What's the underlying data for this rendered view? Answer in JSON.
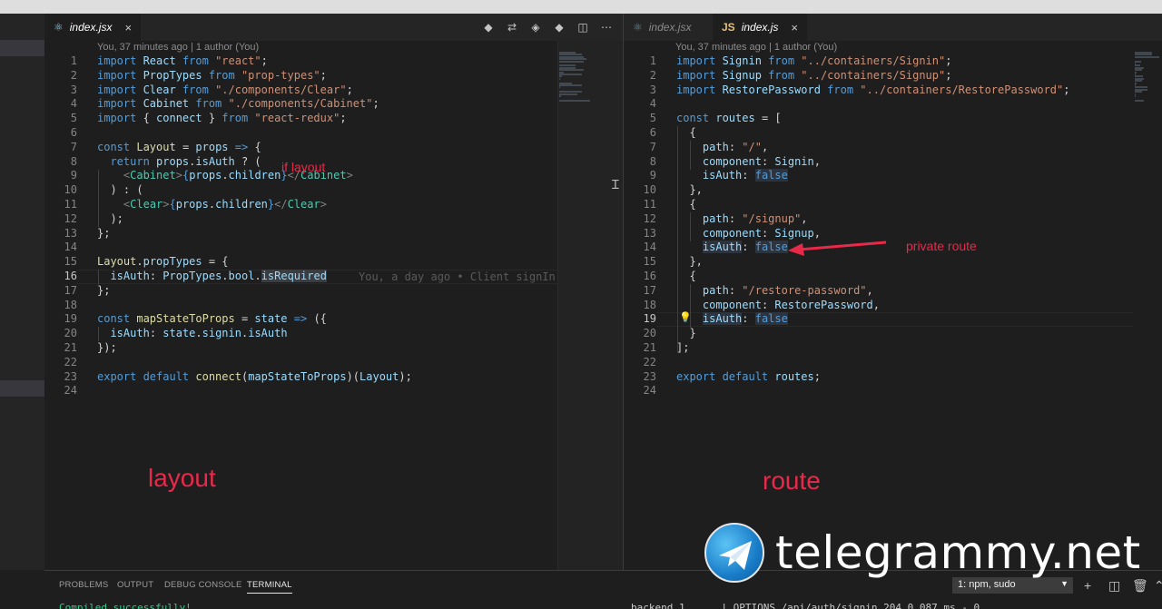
{
  "left_editor": {
    "tab_label": "index.jsx",
    "tab_close": "×",
    "blame": "You, 37 minutes ago | 1 author (You)",
    "ghost_text": "You, a day ago • Client signIn",
    "lines": [
      {
        "n": "1",
        "segs": [
          [
            "kw",
            "import "
          ],
          [
            "va",
            "React "
          ],
          [
            "kw",
            "from "
          ],
          [
            "st",
            "\"react\""
          ],
          [
            "pl",
            ";"
          ]
        ]
      },
      {
        "n": "2",
        "segs": [
          [
            "kw",
            "import "
          ],
          [
            "va",
            "PropTypes "
          ],
          [
            "kw",
            "from "
          ],
          [
            "st",
            "\"prop-types\""
          ],
          [
            "pl",
            ";"
          ]
        ]
      },
      {
        "n": "3",
        "segs": [
          [
            "kw",
            "import "
          ],
          [
            "va",
            "Clear "
          ],
          [
            "kw",
            "from "
          ],
          [
            "st",
            "\"./components/Clear\""
          ],
          [
            "pl",
            ";"
          ]
        ]
      },
      {
        "n": "4",
        "segs": [
          [
            "kw",
            "import "
          ],
          [
            "va",
            "Cabinet "
          ],
          [
            "kw",
            "from "
          ],
          [
            "st",
            "\"./components/Cabinet\""
          ],
          [
            "pl",
            ";"
          ]
        ]
      },
      {
        "n": "5",
        "segs": [
          [
            "kw",
            "import "
          ],
          [
            "pl",
            "{ "
          ],
          [
            "va",
            "connect "
          ],
          [
            "pl",
            "} "
          ],
          [
            "kw",
            "from "
          ],
          [
            "st",
            "\"react-redux\""
          ],
          [
            "pl",
            ";"
          ]
        ]
      },
      {
        "n": "6",
        "segs": []
      },
      {
        "n": "7",
        "segs": [
          [
            "kw",
            "const "
          ],
          [
            "fn",
            "Layout "
          ],
          [
            "pl",
            "= "
          ],
          [
            "va",
            "props "
          ],
          [
            "kw",
            "=> "
          ],
          [
            "pl",
            "{"
          ]
        ]
      },
      {
        "n": "8",
        "segs": [
          [
            "pl",
            "  "
          ],
          [
            "kw",
            "return "
          ],
          [
            "va",
            "props"
          ],
          [
            "pl",
            "."
          ],
          [
            "va",
            "isAuth "
          ],
          [
            "pl",
            "? ("
          ]
        ]
      },
      {
        "n": "9",
        "segs": [
          [
            "pl",
            "    "
          ],
          [
            "tgc",
            "<"
          ],
          [
            "ty",
            "Cabinet"
          ],
          [
            "tgc",
            ">"
          ],
          [
            "kw",
            "{"
          ],
          [
            "va",
            "props"
          ],
          [
            "pl",
            "."
          ],
          [
            "va",
            "children"
          ],
          [
            "kw",
            "}"
          ],
          [
            "tgc",
            "</"
          ],
          [
            "ty",
            "Cabinet"
          ],
          [
            "tgc",
            ">"
          ]
        ]
      },
      {
        "n": "10",
        "segs": [
          [
            "pl",
            "  ) : ("
          ]
        ]
      },
      {
        "n": "11",
        "segs": [
          [
            "pl",
            "    "
          ],
          [
            "tgc",
            "<"
          ],
          [
            "ty",
            "Clear"
          ],
          [
            "tgc",
            ">"
          ],
          [
            "kw",
            "{"
          ],
          [
            "va",
            "props"
          ],
          [
            "pl",
            "."
          ],
          [
            "va",
            "children"
          ],
          [
            "kw",
            "}"
          ],
          [
            "tgc",
            "</"
          ],
          [
            "ty",
            "Clear"
          ],
          [
            "tgc",
            ">"
          ]
        ]
      },
      {
        "n": "12",
        "segs": [
          [
            "pl",
            "  );"
          ]
        ]
      },
      {
        "n": "13",
        "segs": [
          [
            "pl",
            "};"
          ]
        ]
      },
      {
        "n": "14",
        "segs": []
      },
      {
        "n": "15",
        "segs": [
          [
            "fn",
            "Layout"
          ],
          [
            "pl",
            "."
          ],
          [
            "va",
            "propTypes "
          ],
          [
            "pl",
            "= {"
          ]
        ]
      },
      {
        "n": "16",
        "segs": [
          [
            "pl",
            "  "
          ],
          [
            "va",
            "isAuth"
          ],
          [
            "pl",
            ": "
          ],
          [
            "va",
            "PropTypes"
          ],
          [
            "pl",
            "."
          ],
          [
            "va",
            "bool"
          ],
          [
            "pl",
            "."
          ],
          [
            "hl",
            "isRequired"
          ]
        ]
      },
      {
        "n": "17",
        "segs": [
          [
            "pl",
            "};"
          ]
        ]
      },
      {
        "n": "18",
        "segs": []
      },
      {
        "n": "19",
        "segs": [
          [
            "kw",
            "const "
          ],
          [
            "fn",
            "mapStateToProps "
          ],
          [
            "pl",
            "= "
          ],
          [
            "va",
            "state "
          ],
          [
            "kw",
            "=> "
          ],
          [
            "pl",
            "({"
          ]
        ]
      },
      {
        "n": "20",
        "segs": [
          [
            "pl",
            "  "
          ],
          [
            "va",
            "isAuth"
          ],
          [
            "pl",
            ": "
          ],
          [
            "va",
            "state"
          ],
          [
            "pl",
            "."
          ],
          [
            "va",
            "signin"
          ],
          [
            "pl",
            "."
          ],
          [
            "va",
            "isAuth"
          ]
        ]
      },
      {
        "n": "21",
        "segs": [
          [
            "pl",
            "});"
          ]
        ]
      },
      {
        "n": "22",
        "segs": []
      },
      {
        "n": "23",
        "segs": [
          [
            "kw",
            "export "
          ],
          [
            "kw",
            "default "
          ],
          [
            "fn",
            "connect"
          ],
          [
            "pl",
            "("
          ],
          [
            "va",
            "mapStateToProps"
          ],
          [
            "pl",
            ")("
          ],
          [
            "va",
            "Layout"
          ],
          [
            "pl",
            ");"
          ]
        ]
      },
      {
        "n": "24",
        "segs": []
      }
    ]
  },
  "right_editor": {
    "tab_inactive_label": "index.jsx",
    "tab_active_label": "index.js",
    "js_badge": "JS",
    "blame": "You, 37 minutes ago | 1 author (You)",
    "lines": [
      {
        "n": "1",
        "segs": [
          [
            "kw",
            "import "
          ],
          [
            "va",
            "Signin "
          ],
          [
            "kw",
            "from "
          ],
          [
            "st",
            "\"../containers/Signin\""
          ],
          [
            "pl",
            ";"
          ]
        ]
      },
      {
        "n": "2",
        "segs": [
          [
            "kw",
            "import "
          ],
          [
            "va",
            "Signup "
          ],
          [
            "kw",
            "from "
          ],
          [
            "st",
            "\"../containers/Signup\""
          ],
          [
            "pl",
            ";"
          ]
        ]
      },
      {
        "n": "3",
        "segs": [
          [
            "kw",
            "import "
          ],
          [
            "va",
            "RestorePassword "
          ],
          [
            "kw",
            "from "
          ],
          [
            "st",
            "\"../containers/RestorePassword\""
          ],
          [
            "pl",
            ";"
          ]
        ]
      },
      {
        "n": "4",
        "segs": []
      },
      {
        "n": "5",
        "segs": [
          [
            "kw",
            "const "
          ],
          [
            "va",
            "routes "
          ],
          [
            "pl",
            "= ["
          ]
        ]
      },
      {
        "n": "6",
        "segs": [
          [
            "pl",
            "  {"
          ]
        ]
      },
      {
        "n": "7",
        "segs": [
          [
            "pl",
            "    "
          ],
          [
            "va",
            "path"
          ],
          [
            "pl",
            ": "
          ],
          [
            "st",
            "\"/\""
          ],
          [
            "pl",
            ","
          ]
        ]
      },
      {
        "n": "8",
        "segs": [
          [
            "pl",
            "    "
          ],
          [
            "va",
            "component"
          ],
          [
            "pl",
            ": "
          ],
          [
            "va",
            "Signin"
          ],
          [
            "pl",
            ","
          ]
        ]
      },
      {
        "n": "9",
        "segs": [
          [
            "pl",
            "    "
          ],
          [
            "va",
            "isAuth"
          ],
          [
            "pl",
            ": "
          ],
          [
            "kw",
            "false"
          ]
        ]
      },
      {
        "n": "10",
        "segs": [
          [
            "pl",
            "  },"
          ]
        ]
      },
      {
        "n": "11",
        "segs": [
          [
            "pl",
            "  {"
          ]
        ]
      },
      {
        "n": "12",
        "segs": [
          [
            "pl",
            "    "
          ],
          [
            "va",
            "path"
          ],
          [
            "pl",
            ": "
          ],
          [
            "st",
            "\"/signup\""
          ],
          [
            "pl",
            ","
          ]
        ]
      },
      {
        "n": "13",
        "segs": [
          [
            "pl",
            "    "
          ],
          [
            "va",
            "component"
          ],
          [
            "pl",
            ": "
          ],
          [
            "va",
            "Signup"
          ],
          [
            "pl",
            ","
          ]
        ]
      },
      {
        "n": "14",
        "segs": [
          [
            "pl",
            "    "
          ],
          [
            "va",
            "isAuth"
          ],
          [
            "pl",
            ": "
          ],
          [
            "kw",
            "false"
          ]
        ]
      },
      {
        "n": "15",
        "segs": [
          [
            "pl",
            "  },"
          ]
        ]
      },
      {
        "n": "16",
        "segs": [
          [
            "pl",
            "  {"
          ]
        ]
      },
      {
        "n": "17",
        "segs": [
          [
            "pl",
            "    "
          ],
          [
            "va",
            "path"
          ],
          [
            "pl",
            ": "
          ],
          [
            "st",
            "\"/restore-password\""
          ],
          [
            "pl",
            ","
          ]
        ]
      },
      {
        "n": "18",
        "segs": [
          [
            "pl",
            "    "
          ],
          [
            "va",
            "component"
          ],
          [
            "pl",
            ": "
          ],
          [
            "va",
            "RestorePassword"
          ],
          [
            "pl",
            ","
          ]
        ]
      },
      {
        "n": "19",
        "segs": [
          [
            "pl",
            "    "
          ],
          [
            "va",
            "isAuth"
          ],
          [
            "pl",
            ": "
          ],
          [
            "kw",
            "false"
          ]
        ]
      },
      {
        "n": "20",
        "segs": [
          [
            "pl",
            "  }"
          ]
        ]
      },
      {
        "n": "21",
        "segs": [
          [
            "pl",
            "];"
          ]
        ]
      },
      {
        "n": "22",
        "segs": []
      },
      {
        "n": "23",
        "segs": [
          [
            "kw",
            "export "
          ],
          [
            "kw",
            "default "
          ],
          [
            "va",
            "routes"
          ],
          [
            "pl",
            ";"
          ]
        ]
      },
      {
        "n": "24",
        "segs": []
      }
    ]
  },
  "annotations": {
    "if_layout": "if layout",
    "private_route": "private route",
    "layout": "layout",
    "route": "route",
    "color": "#e8294a"
  },
  "panel": {
    "tabs": [
      "PROBLEMS",
      "OUTPUT",
      "DEBUG CONSOLE",
      "TERMINAL"
    ],
    "active_tab": "TERMINAL",
    "terminal_select": "1: npm, sudo",
    "left_output": "Compiled successfully!",
    "right_output": "backend_1      | OPTIONS /api/auth/signin 204 0.087 ms - 0"
  },
  "watermark": {
    "text": "telegrammy.net"
  },
  "colors": {
    "editor_bg": "#1e1e1e",
    "sidebar_bg": "#252526",
    "keyword": "#569cd6",
    "string": "#ce9178",
    "variable": "#9cdcfe",
    "function": "#dcdcaa",
    "type": "#4ec9b0"
  }
}
